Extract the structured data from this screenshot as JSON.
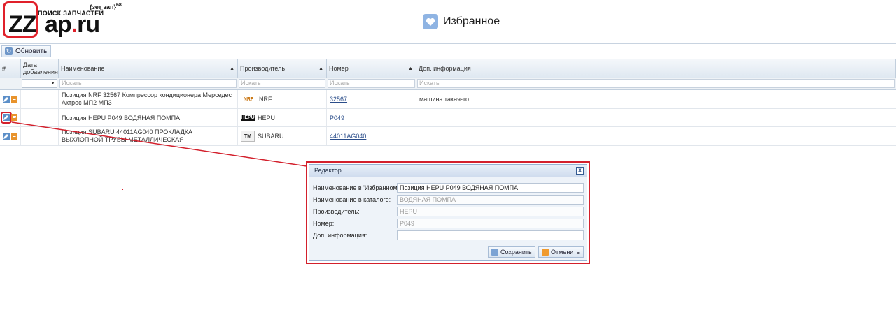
{
  "logo": {
    "brand_main": "ZZ",
    "brand_rest": "ap",
    "brand_dot": ".",
    "brand_tld": "ru",
    "subtitle": "ПОИСК ЗАПЧАСТЕЙ",
    "tagline": "{зет зап}",
    "tagline_sup": "68"
  },
  "page": {
    "title": "Избранное",
    "title_icon": "heart-icon"
  },
  "toolbar": {
    "refresh_label": "Обновить",
    "refresh_icon": "refresh-icon"
  },
  "grid": {
    "columns": {
      "index": "#",
      "date": "Дата добавления",
      "name": "Наименование",
      "manufacturer": "Производитель",
      "number": "Номер",
      "info": "Доп. информация"
    },
    "filter_placeholder": "Искать",
    "rows": [
      {
        "name": "Позиция NRF 32567 Компрессор кондиционера Мерседес Актрос МП2 МП3",
        "manufacturer": "NRF",
        "number": "32567",
        "info": "машина такая-то"
      },
      {
        "name": "Позиция HEPU P049 ВОДЯНАЯ ПОМПА",
        "manufacturer": "HEPU",
        "number": "P049",
        "info": ""
      },
      {
        "name": "Позиция SUBARU 44011AG040 ПРОКЛАДКА ВЫХЛОПНОЙ ТРУБЫ МЕТАЛЛИЧЕСКАЯ",
        "manufacturer": "SUBARU",
        "number": "44011AG040",
        "info": ""
      }
    ],
    "brand_badges": {
      "nrf": "NRF",
      "hepu": "HEPU",
      "subaru": "TM"
    }
  },
  "editor": {
    "title": "Редактор",
    "close_label": "x",
    "fields": {
      "fav_name_label": "Наименование в 'Избранном':",
      "fav_name_value": "Позиция HEPU P049 ВОДЯНАЯ ПОМПА",
      "catalog_name_label": "Наименование в каталоге:",
      "catalog_name_value": "ВОДЯНАЯ ПОМПА",
      "manufacturer_label": "Производитель:",
      "manufacturer_value": "HEPU",
      "number_label": "Номер:",
      "number_value": "P049",
      "info_label": "Доп. информация:",
      "info_value": ""
    },
    "save_label": "Сохранить",
    "cancel_label": "Отменить"
  },
  "colors": {
    "highlight": "#d3202c",
    "accent_blue": "#5c8fc8",
    "accent_orange": "#e8932c"
  }
}
